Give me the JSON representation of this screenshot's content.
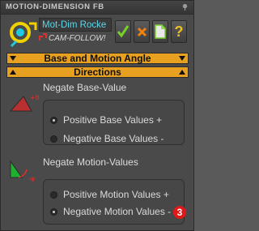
{
  "window": {
    "title": "MOTION-DIMENSION FB"
  },
  "header": {
    "name_value": "Mot-Dim Rocke",
    "follower": "CAM-FOLLOW!"
  },
  "toolbar": {
    "ok": "ok-icon",
    "cancel": "cancel-icon",
    "new": "new-document-icon",
    "help": "?"
  },
  "bars": {
    "base_motion": "Base and Motion Angle",
    "directions": "Directions"
  },
  "negate_base": {
    "label": "Negate Base-Value",
    "options": [
      "Positive Base Values +",
      "Negative Base Values -"
    ],
    "selected": 0
  },
  "negate_motion": {
    "label": "Negate Motion-Values",
    "options": [
      "Positive Motion Values +",
      "Negative Motion Values -"
    ],
    "selected": 1
  },
  "badge": "3",
  "colors": {
    "accent_bar": "#e8a020",
    "name_text": "#5fd6e8",
    "badge": "#e01818"
  }
}
